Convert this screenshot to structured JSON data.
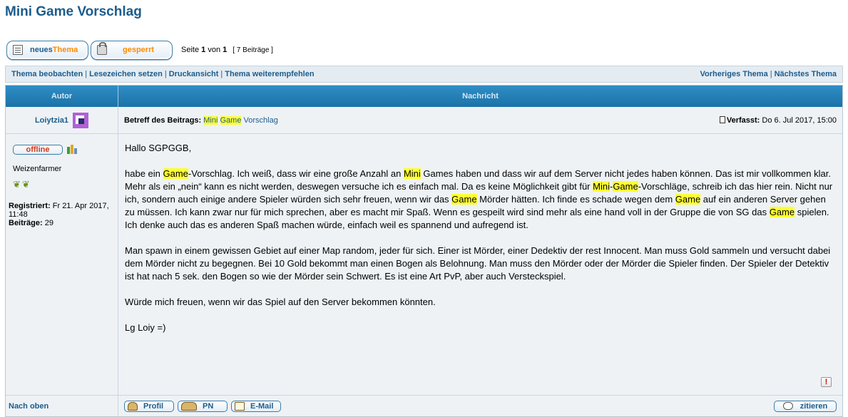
{
  "page": {
    "title": "Mini Game Vorschlag"
  },
  "actions": {
    "new_topic_part1": "neues",
    "new_topic_part2": "Thema",
    "locked": "gesperrt",
    "page_info_prefix": "Seite ",
    "page_current": "1",
    "page_middle": " von ",
    "page_total": "1",
    "post_count": "[ 7 Beiträge ]"
  },
  "navbar": {
    "watch": "Thema beobachten",
    "bookmark": "Lesezeichen setzen",
    "print": "Druckansicht",
    "recommend": "Thema weiterempfehlen",
    "prev": "Vorheriges Thema",
    "next": "Nächstes Thema",
    "separator": "|"
  },
  "table_header": {
    "author": "Autor",
    "message": "Nachricht"
  },
  "post": {
    "author": "Loiytzia1",
    "subject_label": "Betreff des Beitrags:",
    "subject_word1": "Mini",
    "subject_word2": "Game",
    "subject_word3": "Vorschlag",
    "posted_label": "Verfasst:",
    "posted_date": "Do 6. Jul 2017, 15:00",
    "status": "offline",
    "rank": "Weizenfarmer",
    "registered_label": "Registriert:",
    "registered_value": "Fr 21. Apr 2017, 11:48",
    "posts_label": "Beiträge:",
    "posts_value": "29",
    "body": {
      "greeting": "Hallo SGPGGB,",
      "p1": [
        "habe ein ",
        "Game",
        "-Vorschlag. Ich weiß, dass wir eine große Anzahl an ",
        "Mini",
        " Games haben und dass wir auf dem Server nicht jedes haben können. Das ist mir vollkommen klar. Mehr als ein „nein“ kann es nicht werden, deswegen versuche ich es einfach mal. Da es keine Möglichkeit gibt für ",
        "Mini",
        "-",
        "Game",
        "-Vorschläge, schreib ich das hier rein. Nicht nur ich, sondern auch einige andere Spieler würden sich sehr freuen, wenn wir das ",
        "Game",
        " Mörder hätten. Ich finde es schade wegen dem ",
        "Game",
        " auf ein anderen Server gehen zu müssen. Ich kann zwar nur für mich sprechen, aber es macht mir Spaß. Wenn es gespeilt wird sind mehr als eine hand voll in der Gruppe die von SG das ",
        "Game",
        " spielen. Ich denke auch das es anderen Spaß machen würde, einfach weil es spannend und aufregend ist."
      ],
      "p2": "Man spawn in einem gewissen Gebiet auf einer Map random, jeder für sich. Einer ist Mörder, einer Dedektiv der rest Innocent. Man muss Gold sammeln und versucht dabei dem Mörder nicht zu begegnen. Bei 10 Gold bekommt man einen Bogen als Belohnung. Man muss den Mörder oder der Mörder die Spieler finden. Der Spieler der Detektiv ist hat nach 5 sek. den Bogen so wie der Mörder sein Schwert. Es ist eine Art PvP, aber auch Versteckspiel.",
      "p3": "Würde mich freuen, wenn wir das Spiel auf den Server bekommen könnten.",
      "p4": "Lg Loiy =)"
    },
    "report": "!"
  },
  "footer": {
    "back_to_top": "Nach oben",
    "profile": "Profil",
    "pm": "PN",
    "email": "E-Mail",
    "quote": "zitieren"
  },
  "colors": {
    "link": "#1c5c8c",
    "accent_orange": "#ff8a00",
    "header_bg": "#1b72a8",
    "highlight": "#ffff33",
    "offline": "#d23b1b"
  }
}
